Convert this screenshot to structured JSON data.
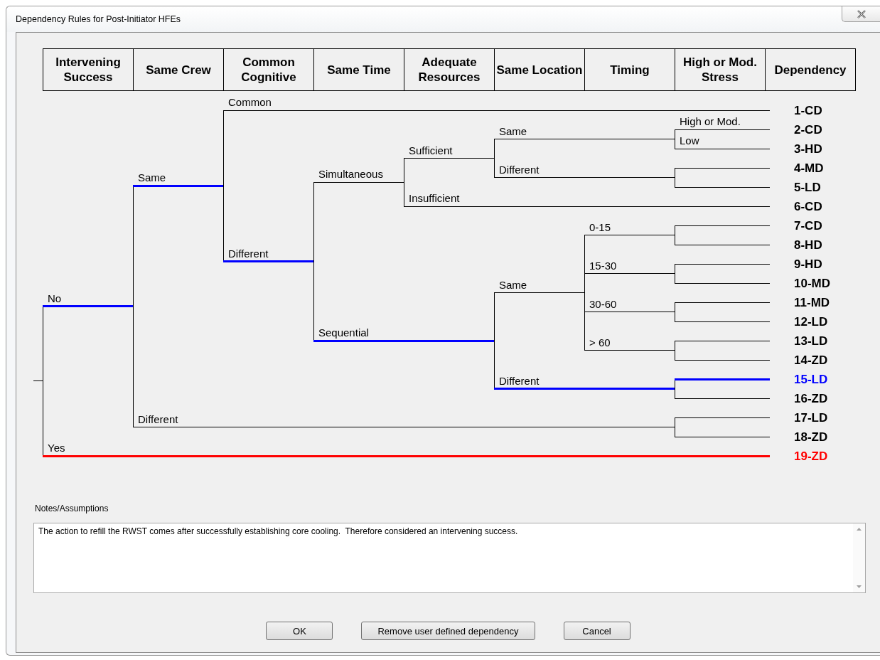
{
  "window": {
    "title": "Dependency Rules for Post-Initiator HFEs"
  },
  "columns": [
    "Intervening Success",
    "Same Crew",
    "Common Cognitive",
    "Same Time",
    "Adequate Resources",
    "Same Location",
    "Timing",
    "High or Mod. Stress",
    "Dependency"
  ],
  "tree": {
    "branches": [
      {
        "label": "No",
        "color": "#0000ff",
        "children": [
          {
            "label": "Same",
            "color": "#0000ff",
            "children": [
              {
                "label": "Common",
                "color": "#000000",
                "outcome": "1-CD"
              },
              {
                "label": "Different",
                "color": "#0000ff",
                "children": [
                  {
                    "label": "Simultaneous",
                    "color": "#000000",
                    "children": [
                      {
                        "label": "Sufficient",
                        "color": "#000000",
                        "children": [
                          {
                            "label": "Same",
                            "color": "#000000",
                            "children": [
                              {
                                "color": "#000000",
                                "children": [
                                  {
                                    "label": "High or Mod.",
                                    "color": "#000000",
                                    "outcome": "2-CD"
                                  },
                                  {
                                    "label": "Low",
                                    "color": "#000000",
                                    "outcome": "3-HD"
                                  }
                                ]
                              }
                            ]
                          },
                          {
                            "label": "Different",
                            "color": "#000000",
                            "children": [
                              {
                                "color": "#000000",
                                "children": [
                                  {
                                    "color": "#000000",
                                    "outcome": "4-MD"
                                  },
                                  {
                                    "color": "#000000",
                                    "outcome": "5-LD"
                                  }
                                ]
                              }
                            ]
                          }
                        ]
                      },
                      {
                        "label": "Insufficient",
                        "color": "#000000",
                        "outcome": "6-CD"
                      }
                    ]
                  },
                  {
                    "label": "Sequential",
                    "color": "#0000ff",
                    "children": [
                      {
                        "color": "#0000ff",
                        "children": [
                          {
                            "label": "Same",
                            "color": "#000000",
                            "children": [
                              {
                                "label": "0-15",
                                "color": "#000000",
                                "children": [
                                  {
                                    "color": "#000000",
                                    "outcome": "7-CD"
                                  },
                                  {
                                    "color": "#000000",
                                    "outcome": "8-HD"
                                  }
                                ]
                              },
                              {
                                "label": "15-30",
                                "color": "#000000",
                                "children": [
                                  {
                                    "color": "#000000",
                                    "outcome": "9-HD"
                                  },
                                  {
                                    "color": "#000000",
                                    "outcome": "10-MD"
                                  }
                                ]
                              },
                              {
                                "label": "30-60",
                                "color": "#000000",
                                "children": [
                                  {
                                    "color": "#000000",
                                    "outcome": "11-MD"
                                  },
                                  {
                                    "color": "#000000",
                                    "outcome": "12-LD"
                                  }
                                ]
                              },
                              {
                                "label": "> 60",
                                "color": "#000000",
                                "children": [
                                  {
                                    "color": "#000000",
                                    "outcome": "13-LD"
                                  },
                                  {
                                    "color": "#000000",
                                    "outcome": "14-ZD"
                                  }
                                ]
                              }
                            ]
                          },
                          {
                            "label": "Different",
                            "color": "#0000ff",
                            "children": [
                              {
                                "color": "#0000ff",
                                "children": [
                                  {
                                    "color": "#0000ff",
                                    "outcome": "15-LD"
                                  },
                                  {
                                    "color": "#000000",
                                    "outcome": "16-ZD"
                                  }
                                ]
                              }
                            ]
                          }
                        ]
                      }
                    ]
                  }
                ]
              }
            ]
          },
          {
            "label": "Different",
            "color": "#000000",
            "children": [
              {
                "color": "#000000",
                "children": [
                  {
                    "color": "#000000",
                    "children": [
                      {
                        "color": "#000000",
                        "children": [
                          {
                            "color": "#000000",
                            "children": [
                              {
                                "color": "#000000",
                                "children": [
                                  {
                                    "color": "#000000",
                                    "outcome": "17-LD"
                                  },
                                  {
                                    "color": "#000000",
                                    "outcome": "18-ZD"
                                  }
                                ]
                              }
                            ]
                          }
                        ]
                      }
                    ]
                  }
                ]
              }
            ]
          }
        ]
      },
      {
        "label": "Yes",
        "color": "#ff0000",
        "outcome": "19-ZD"
      }
    ]
  },
  "notes": {
    "label": "Notes/Assumptions",
    "value": "The action to refill the RWST comes after successfully establishing core cooling.  Therefore considered an intervening success."
  },
  "buttons": [
    "OK",
    "Remove user defined dependency",
    "Cancel"
  ]
}
